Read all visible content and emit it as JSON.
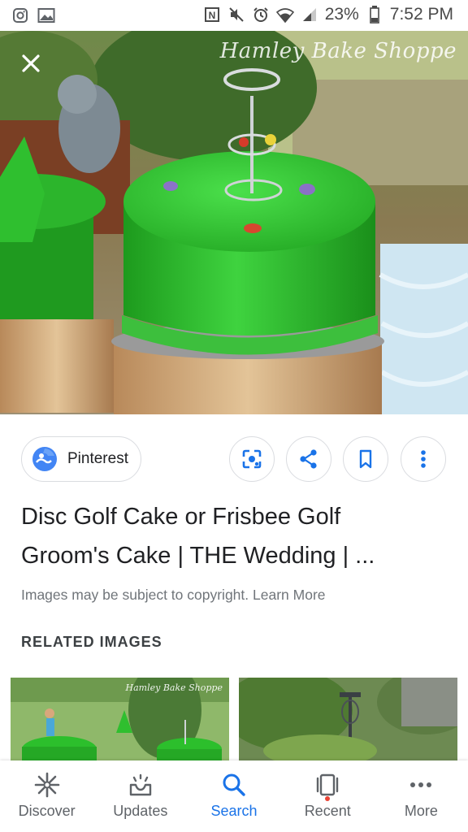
{
  "status_bar": {
    "left_icons": [
      "instagram-icon",
      "gallery-icon"
    ],
    "right_icons": [
      "nfc-icon",
      "mute-icon",
      "alarm-icon",
      "wifi-icon",
      "signal-icon"
    ],
    "battery": "23%",
    "time": "7:52 PM"
  },
  "hero": {
    "watermark": "Hamley Bake Shoppe",
    "close_icon": "close-icon"
  },
  "source": {
    "label": "Pinterest",
    "icon": "pinterest-icon"
  },
  "actions": [
    {
      "name": "lens-icon"
    },
    {
      "name": "share-icon"
    },
    {
      "name": "bookmark-icon"
    },
    {
      "name": "more-vert-icon"
    }
  ],
  "result": {
    "title_line1": "Disc Golf Cake or Frisbee Golf",
    "title_line2": "Groom's Cake | THE Wedding | ...",
    "copyright_text": "Images may be subject to copyright.",
    "learn_more": "Learn More"
  },
  "related": {
    "heading": "RELATED IMAGES",
    "thumb1_watermark": "Hamley Bake Shoppe"
  },
  "bottom_nav": {
    "items": [
      {
        "label": "Discover",
        "icon": "discover-icon"
      },
      {
        "label": "Updates",
        "icon": "updates-icon"
      },
      {
        "label": "Search",
        "icon": "search-icon"
      },
      {
        "label": "Recent",
        "icon": "recent-icon"
      },
      {
        "label": "More",
        "icon": "more-icon"
      }
    ],
    "active": "Search"
  },
  "colors": {
    "accent": "#1a73e8",
    "cake_green": "#2ebd2e",
    "text_primary": "#202124",
    "text_secondary": "#70757a",
    "notification_dot": "#ea4335"
  }
}
